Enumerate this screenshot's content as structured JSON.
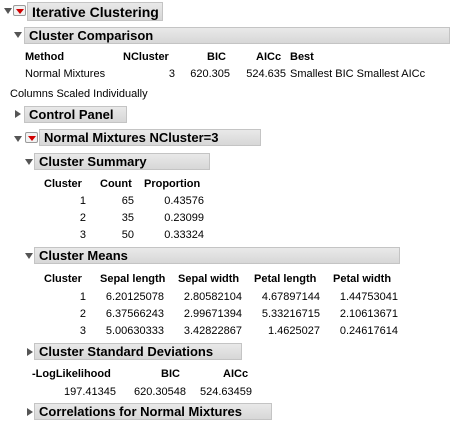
{
  "window": {
    "title": "Iterative Clustering"
  },
  "cluster_comparison": {
    "title": "Cluster Comparison",
    "columns": [
      "Method",
      "NCluster",
      "BIC",
      "AICc",
      "Best"
    ],
    "row": {
      "method": "Normal Mixtures",
      "ncluster": "3",
      "bic": "620.305",
      "aicc": "524.635",
      "best": "Smallest BIC Smallest AICc"
    }
  },
  "scaling_note": "Columns Scaled Individually",
  "control_panel": {
    "title": "Control Panel"
  },
  "normal_mixtures": {
    "title": "Normal Mixtures NCluster=3",
    "cluster_summary": {
      "title": "Cluster Summary",
      "columns": [
        "Cluster",
        "Count",
        "Proportion"
      ],
      "rows": [
        [
          "1",
          "65",
          "0.43576"
        ],
        [
          "2",
          "35",
          "0.23099"
        ],
        [
          "3",
          "50",
          "0.33324"
        ]
      ]
    },
    "cluster_means": {
      "title": "Cluster Means",
      "columns": [
        "Cluster",
        "Sepal length",
        "Sepal width",
        "Petal length",
        "Petal width"
      ],
      "rows": [
        [
          "1",
          "6.20125078",
          "2.80582104",
          "4.67897144",
          "1.44753041"
        ],
        [
          "2",
          "6.37566243",
          "2.99671394",
          "5.33216715",
          "2.10613671"
        ],
        [
          "3",
          "5.00630333",
          "3.42822867",
          "1.4625027",
          "0.24617614"
        ]
      ]
    },
    "cluster_std_devs": {
      "title": "Cluster Standard Deviations"
    },
    "fit_stats": {
      "columns": [
        "-LogLikelihood",
        "BIC",
        "AICc"
      ],
      "values": [
        "197.41345",
        "620.30548",
        "524.63459"
      ]
    },
    "correlations": {
      "title": "Correlations for Normal Mixtures"
    }
  }
}
